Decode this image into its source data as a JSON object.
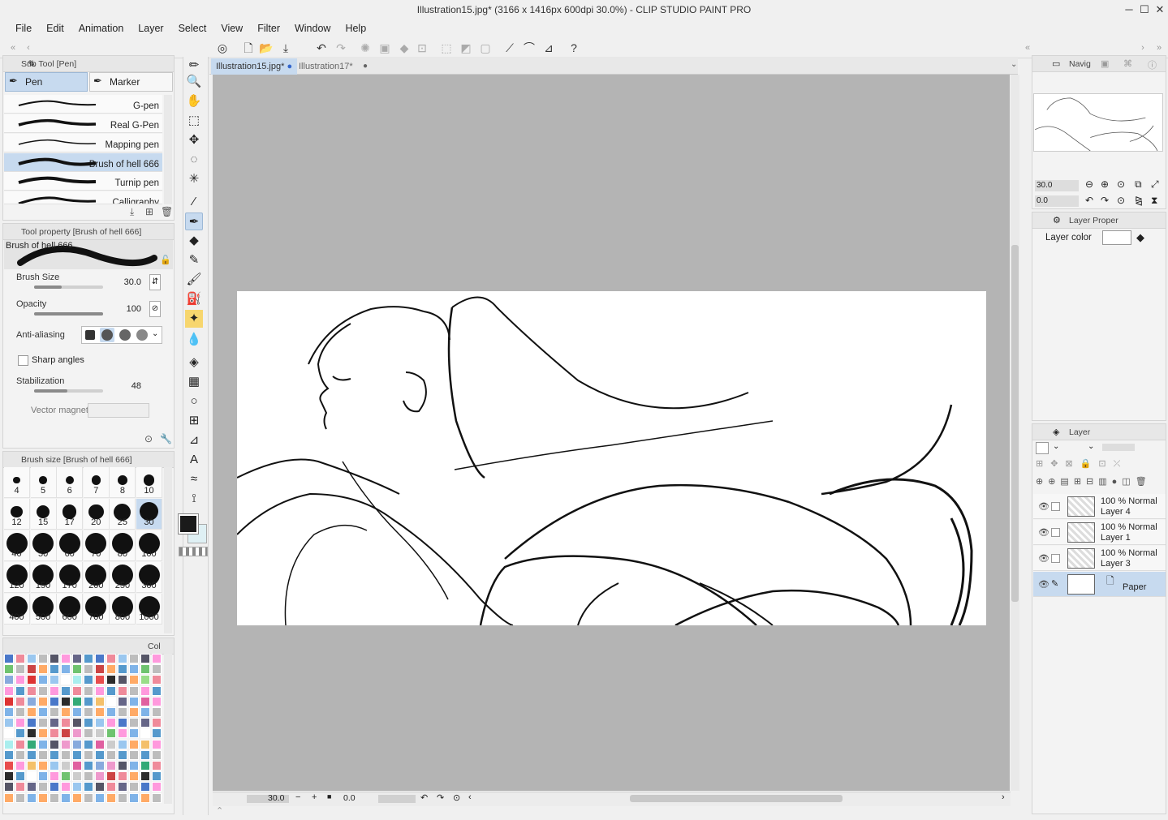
{
  "window": {
    "title": "Illustration15.jpg* (3166 x 1416px 600dpi 30.0%)  - CLIP STUDIO PAINT PRO"
  },
  "menu": [
    "File",
    "Edit",
    "Animation",
    "Layer",
    "Select",
    "View",
    "Filter",
    "Window",
    "Help"
  ],
  "doc_tabs": [
    {
      "label": "Illustration15.jpg*",
      "active": true
    },
    {
      "label": "Illustration17*",
      "active": false
    }
  ],
  "subtool": {
    "header": "Sub Tool [Pen]",
    "groups": [
      "Pen",
      "Marker"
    ],
    "brushes": [
      "G-pen",
      "Real G-Pen",
      "Mapping pen",
      "Brush of hell 666",
      "Turnip pen",
      "Calligraphy"
    ],
    "selected_brush": "Brush of hell 666"
  },
  "tool_property": {
    "header": "Tool property [Brush of hell 666]",
    "preview_name": "Brush of hell 666",
    "brush_size_label": "Brush Size",
    "brush_size_value": "30.0",
    "brush_size_level": 0.4,
    "opacity_label": "Opacity",
    "opacity_value": "100",
    "opacity_level": 1.0,
    "antialias_label": "Anti-aliasing",
    "sharp_label": "Sharp angles",
    "stabilization_label": "Stabilization",
    "stabilization_value": "48",
    "stabilization_level": 0.48,
    "vector_magnet_label": "Vector magnet"
  },
  "brush_size_palette": {
    "header": "Brush size [Brush of hell 666]",
    "sizes": [
      "4",
      "5",
      "6",
      "7",
      "8",
      "10",
      "12",
      "15",
      "17",
      "20",
      "25",
      "30",
      "40",
      "50",
      "60",
      "70",
      "80",
      "100",
      "120",
      "150",
      "170",
      "200",
      "250",
      "300",
      "400",
      "500",
      "600",
      "700",
      "800",
      "1000"
    ],
    "selected": "30"
  },
  "color_set": {
    "tab_label": "Col"
  },
  "navigator": {
    "tab_label": "Navig",
    "zoom": "30.0",
    "angle": "0.0"
  },
  "layer_property": {
    "tab_label": "Layer Proper",
    "layer_color_label": "Layer color"
  },
  "layers": {
    "tab_label": "Layer",
    "items": [
      {
        "opacity": "100 %",
        "mode": "Normal",
        "name": "Layer 4"
      },
      {
        "opacity": "100 %",
        "mode": "Normal",
        "name": "Layer 1"
      },
      {
        "opacity": "100 %",
        "mode": "Normal",
        "name": "Layer 3"
      },
      {
        "opacity": "",
        "mode": "",
        "name": "Paper"
      }
    ],
    "selected": "Paper"
  },
  "status": {
    "zoom": "30.0",
    "angle": "0.0"
  },
  "colors": {
    "accent": "#c7daef",
    "canvas_bg": "#b4b4b4",
    "panel": "#f3f3f3"
  }
}
